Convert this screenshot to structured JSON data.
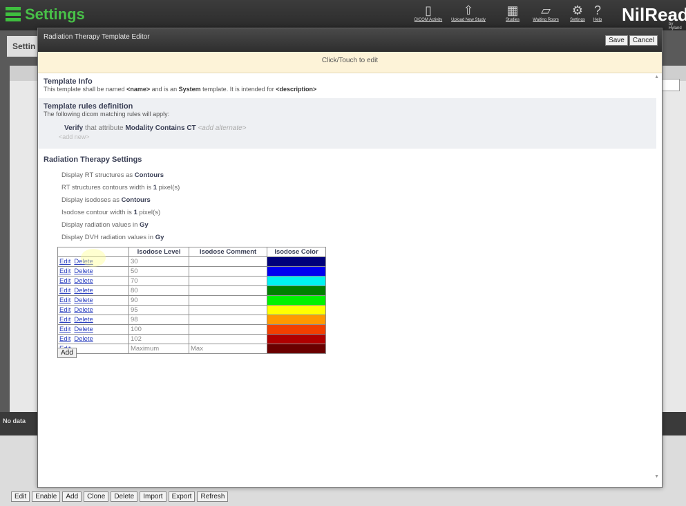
{
  "app": {
    "title": "Settings",
    "brand": "NilRead",
    "brand_sub": "by Hyland",
    "nav": [
      {
        "icon": "dicom-activity-icon",
        "label": "DICOM Activity"
      },
      {
        "icon": "upload-study-icon",
        "label": "Upload New Study"
      },
      {
        "icon": "studies-icon",
        "label": "Studies"
      },
      {
        "icon": "waiting-room-icon",
        "label": "Waiting Room"
      },
      {
        "icon": "settings-icon",
        "label": "Settings"
      },
      {
        "icon": "help-icon",
        "label": "Help"
      }
    ]
  },
  "background": {
    "tab_label": "Settin",
    "no_data": "No data",
    "toolbar": [
      "Edit",
      "Enable",
      "Add",
      "Clone",
      "Delete",
      "Import",
      "Export",
      "Refresh"
    ]
  },
  "dialog": {
    "title": "Radiation Therapy Template Editor",
    "save_label": "Save",
    "cancel_label": "Cancel",
    "edit_hint": "Click/Touch to edit",
    "template_info": {
      "heading": "Template Info",
      "text_1": "This template shall be named ",
      "name": "<name>",
      "text_2": " and is an ",
      "type": "System",
      "text_3": " template. It is intended for ",
      "description": "<description>"
    },
    "rules": {
      "heading": "Template rules definition",
      "desc": "The following dicom matching rules will apply:",
      "verb": "Verify",
      "text_1": " that attribute ",
      "attribute": "Modality",
      "operator": "Contains",
      "value": "CT",
      "add_alternate": "<add alternate>",
      "add_new": "<add new>"
    },
    "rt": {
      "heading": "Radiation Therapy Settings",
      "lines": [
        {
          "text": "Display RT structures as ",
          "value": "Contours",
          "suffix": ""
        },
        {
          "text": "RT structures contours width is ",
          "value": "1",
          "suffix": " pixel(s)"
        },
        {
          "text": "Display isodoses as ",
          "value": "Contours",
          "suffix": ""
        },
        {
          "text": "Isodose contour width is ",
          "value": "1",
          "suffix": " pixel(s)"
        },
        {
          "text": "Display radiation values in ",
          "value": "Gy",
          "suffix": ""
        },
        {
          "text": "Display DVH radiation values in ",
          "value": "Gy",
          "suffix": ""
        }
      ]
    },
    "isodose_table": {
      "headers": [
        "",
        "Isodose Level",
        "Isodose Comment",
        "Isodose Color"
      ],
      "edit_label": "Edit",
      "delete_label": "Delete",
      "rows": [
        {
          "level": "30",
          "comment": "",
          "color": "#00007a",
          "deletable": true
        },
        {
          "level": "50",
          "comment": "",
          "color": "#0000f0",
          "deletable": true
        },
        {
          "level": "70",
          "comment": "",
          "color": "#00f2f2",
          "deletable": true
        },
        {
          "level": "80",
          "comment": "",
          "color": "#008000",
          "deletable": true
        },
        {
          "level": "90",
          "comment": "",
          "color": "#00f200",
          "deletable": true
        },
        {
          "level": "95",
          "comment": "",
          "color": "#ffff00",
          "deletable": true
        },
        {
          "level": "98",
          "comment": "",
          "color": "#ff9900",
          "deletable": true
        },
        {
          "level": "100",
          "comment": "",
          "color": "#f24000",
          "deletable": true
        },
        {
          "level": "102",
          "comment": "",
          "color": "#b00000",
          "deletable": true
        },
        {
          "level": "Maximum",
          "comment": "Max",
          "color": "#6b0000",
          "deletable": false
        }
      ],
      "add_label": "Add"
    }
  }
}
